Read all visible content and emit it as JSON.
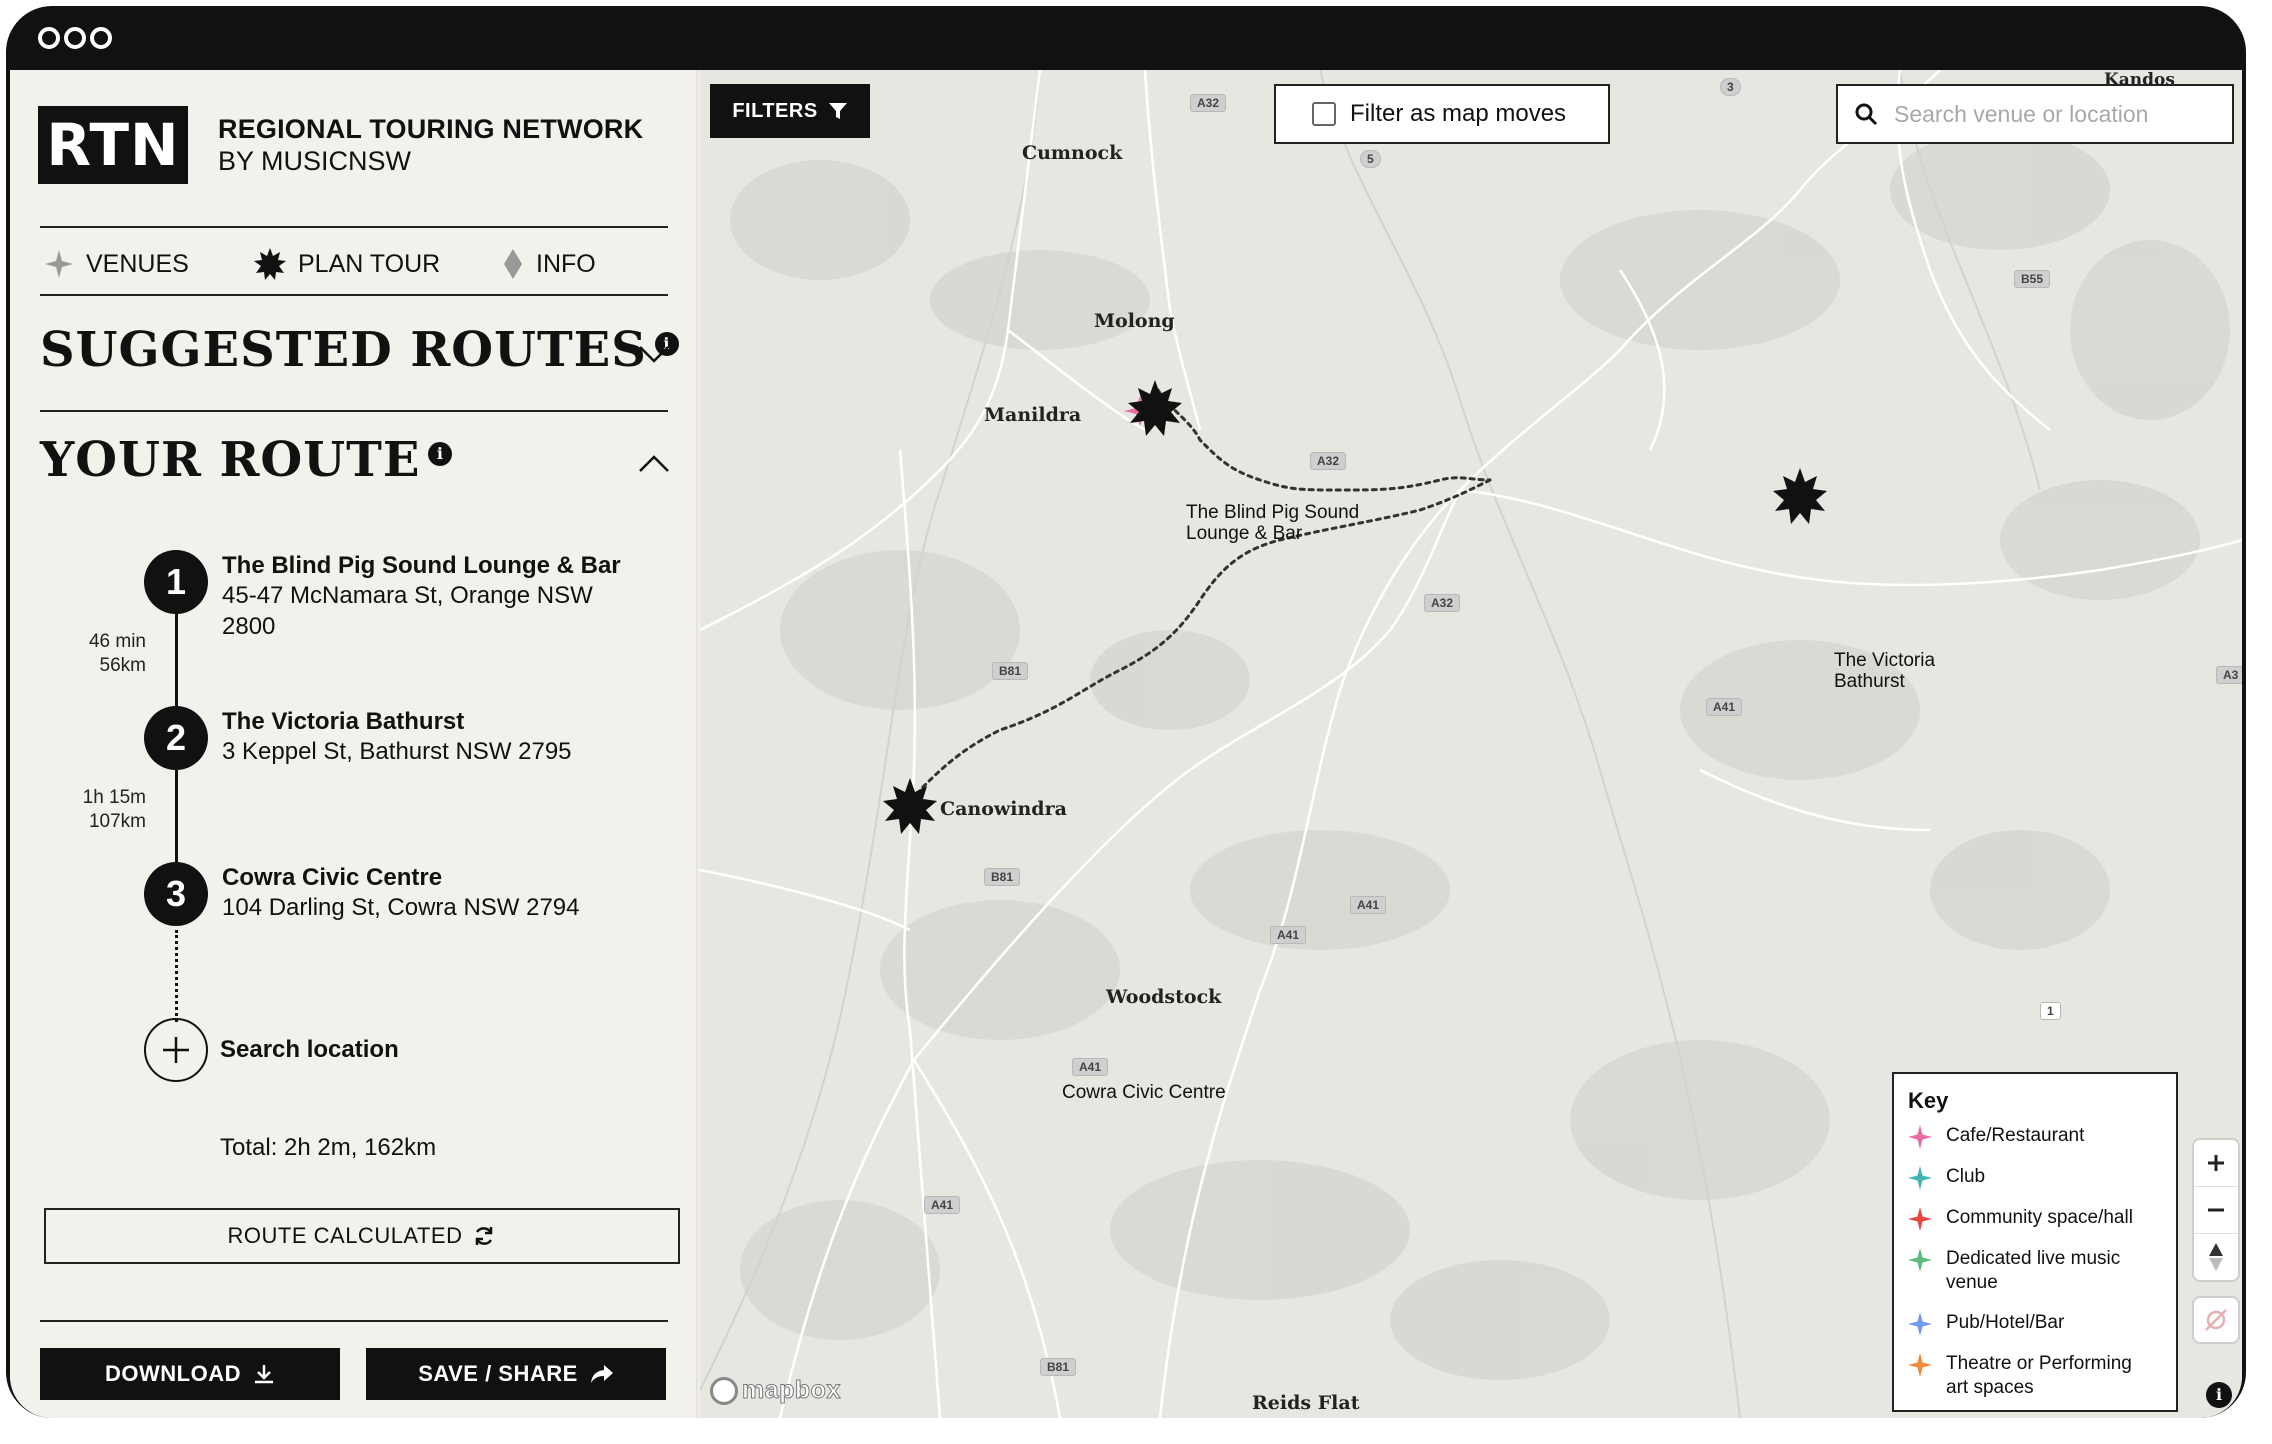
{
  "brand": {
    "logo_text": "RTN",
    "title": "REGIONAL TOURING NETWORK",
    "subtitle": "BY MUSICNSW"
  },
  "nav": {
    "venues": "VENUES",
    "plan_tour": "PLAN TOUR",
    "info": "INFO"
  },
  "suggested_routes": {
    "title": "SUGGESTED ROUTES",
    "info": "i"
  },
  "your_route": {
    "title": "YOUR ROUTE",
    "info": "i",
    "stops": [
      {
        "number": "1",
        "name": "The Blind Pig Sound Lounge & Bar",
        "address": "45-47 McNamara St, Orange NSW 2800"
      },
      {
        "number": "2",
        "name": "The Victoria Bathurst",
        "address": "3 Keppel St, Bathurst NSW 2795"
      },
      {
        "number": "3",
        "name": "Cowra Civic Centre",
        "address": "104 Darling St, Cowra NSW 2794"
      }
    ],
    "legs": [
      {
        "time": "46 min",
        "distance": "56km"
      },
      {
        "time": "1h 15m",
        "distance": "107km"
      }
    ],
    "add_location": "Search location",
    "total": "Total: 2h 2m, 162km"
  },
  "buttons": {
    "route_calculated": "ROUTE CALCULATED",
    "download": "DOWNLOAD",
    "save_share": "SAVE / SHARE"
  },
  "map": {
    "filters_label": "FILTERS",
    "filter_moves_label": "Filter as map moves",
    "filter_moves_checked": false,
    "search_placeholder": "Search venue or location",
    "towns": [
      "Cumnock",
      "Molong",
      "Manildra",
      "Canowindra",
      "Woodstock",
      "Reids Flat"
    ],
    "venue_labels": {
      "blind_pig_1": "The Blind Pig Sound",
      "blind_pig_2": "Lounge & Bar",
      "victoria_1": "The Victoria",
      "victoria_2": "Bathurst",
      "cowra": "Cowra Civic Centre"
    },
    "road_shields": [
      "A32",
      "5",
      "3",
      "B55",
      "A32",
      "A32",
      "B81",
      "A41",
      "B81",
      "A41",
      "A41",
      "A41",
      "A41",
      "1",
      "B81",
      "A3"
    ],
    "attribution_logo": "mapbox",
    "attribution_info": "i",
    "corner_text": "Kandos"
  },
  "legend": {
    "title": "Key",
    "items": [
      {
        "label": "Cafe/Restaurant",
        "color": "#e96ea3"
      },
      {
        "label": "Club",
        "color": "#43b4b4"
      },
      {
        "label": "Community space/hall",
        "color": "#e64540"
      },
      {
        "label": "Dedicated live music venue",
        "color": "#5cba7a"
      },
      {
        "label": "Pub/Hotel/Bar",
        "color": "#6f98ee"
      },
      {
        "label": "Theatre or Performing art spaces",
        "color": "#f08a3c"
      }
    ]
  },
  "colors": {
    "ink": "#111111",
    "paper": "#f3f1ec",
    "map_bg": "#e8e6e1"
  }
}
